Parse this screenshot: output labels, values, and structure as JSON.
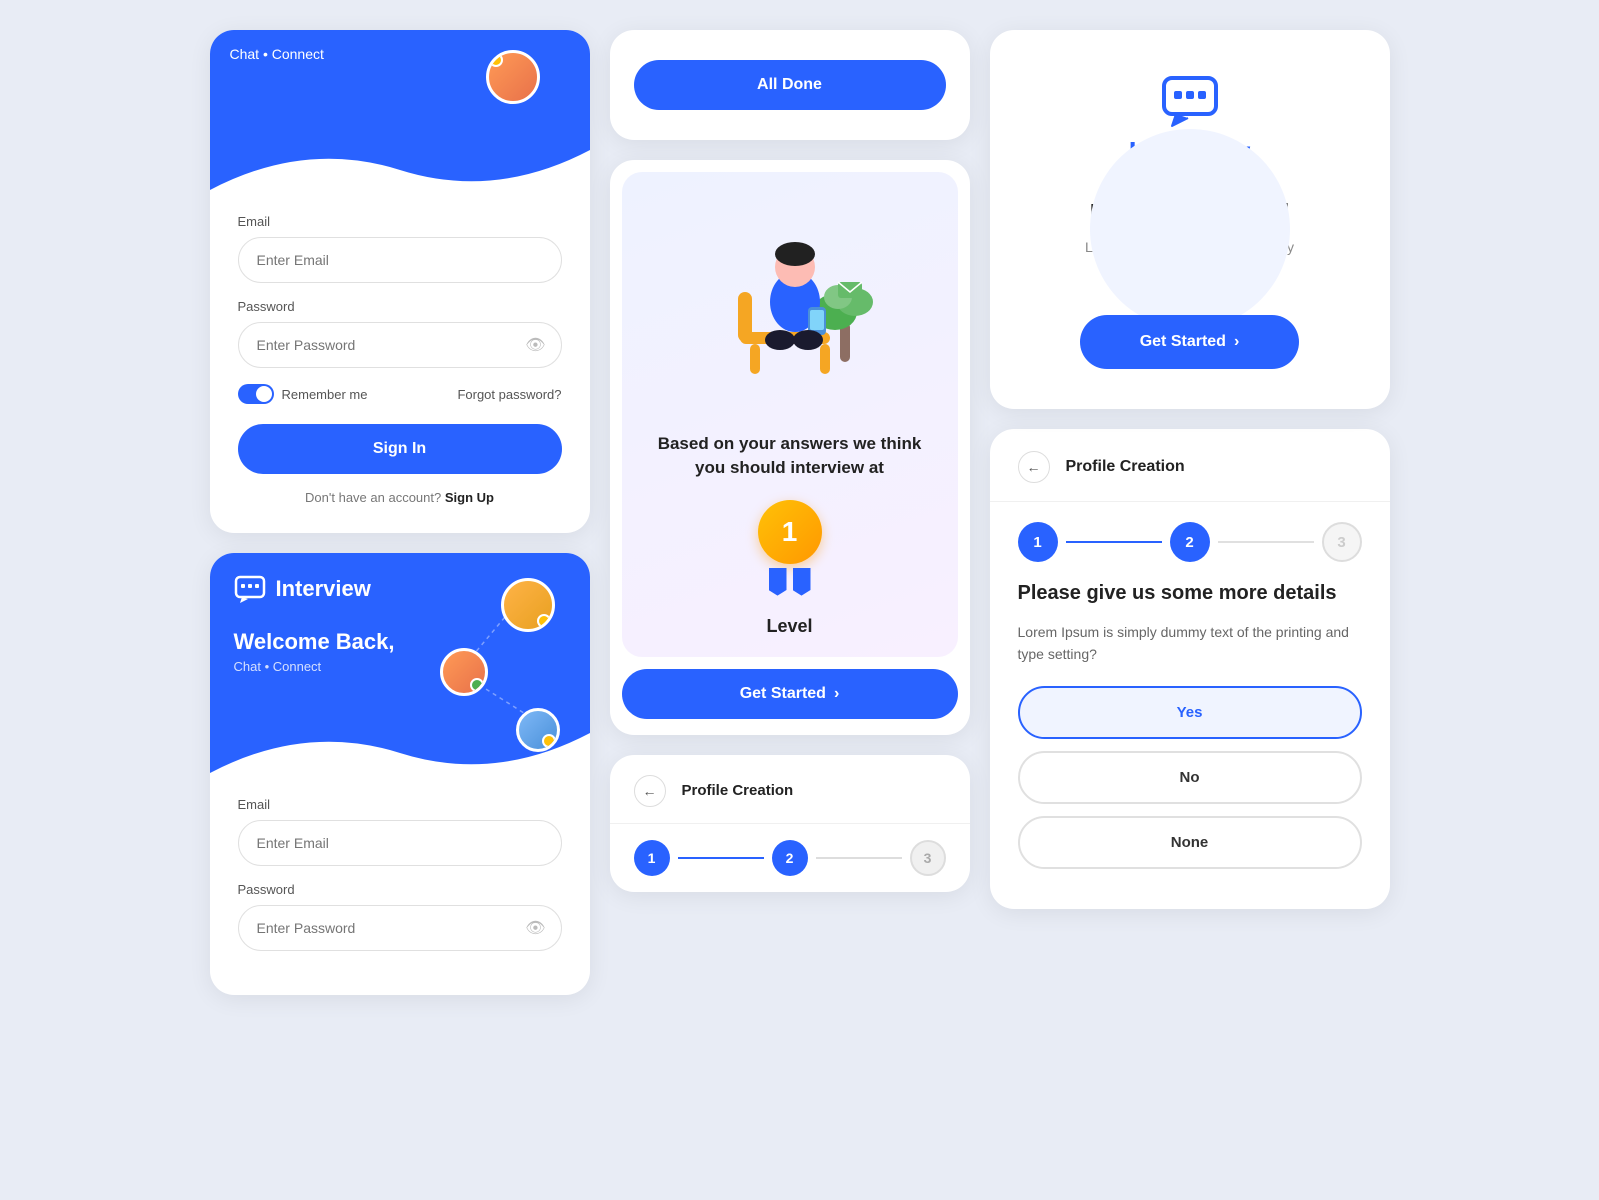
{
  "app": {
    "name": "Interview"
  },
  "col1": {
    "login_card_white": {
      "header": {
        "text": "Chat • Connect"
      },
      "email_label": "Email",
      "email_placeholder": "Enter Email",
      "password_label": "Password",
      "password_placeholder": "Enter Password",
      "remember_me": "Remember me",
      "forgot_password": "Forgot password?",
      "sign_in_btn": "Sign In",
      "no_account_text": "Don't have an account?",
      "sign_up_link": "Sign Up"
    },
    "login_card_blue": {
      "logo_text": "Interview",
      "welcome_text": "Welcome Back,",
      "sub_text": "Chat • Connect",
      "email_label": "Email",
      "email_placeholder": "Enter Email",
      "password_label": "Password",
      "password_placeholder": "Enter Password"
    }
  },
  "col2": {
    "done_card": {
      "btn_label": "All Done"
    },
    "result_card": {
      "description": "Based on your answers we think you should interview at",
      "medal_number": "1",
      "level_label": "Level",
      "btn_label": "Get Started",
      "btn_arrow": "›"
    },
    "profile_small": {
      "title": "Profile Creation",
      "back_icon": "←",
      "steps": [
        {
          "num": "1",
          "active": true
        },
        {
          "num": "2",
          "active": false
        },
        {
          "num": "3",
          "active": false
        }
      ]
    }
  },
  "col3": {
    "get_started_card": {
      "logo_text": "Interview",
      "main_title": "Let's get started",
      "sub_title": "Let's connect and find your buddy",
      "btn_label": "Get Started",
      "btn_arrow": "›"
    },
    "profile_large_card": {
      "title": "Profile Creation",
      "back_icon": "←",
      "steps": [
        {
          "num": "1",
          "active": true
        },
        {
          "num": "2",
          "active": true
        },
        {
          "num": "3",
          "active": false
        }
      ],
      "section_title": "Please give us some more details",
      "question": "Lorem Ipsum is simply dummy text of the printing and type setting?",
      "answers": [
        {
          "label": "Yes",
          "selected": true
        },
        {
          "label": "No",
          "selected": false
        },
        {
          "label": "None",
          "selected": false
        }
      ]
    }
  }
}
